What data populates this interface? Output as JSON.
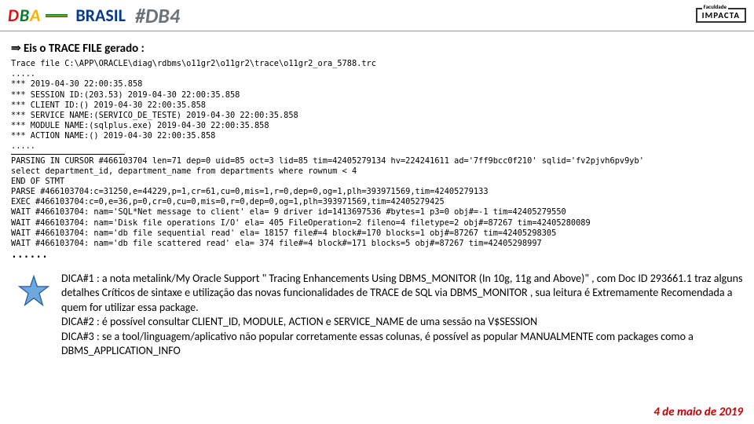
{
  "header": {
    "logo_word": "DBA",
    "brasil": "BRASIL",
    "hash": "#DB4",
    "sponsor_small": "Faculdade",
    "sponsor": "IMPACTA"
  },
  "heading_prefix": "⇒",
  "heading": "Eis o TRACE FILE gerado :",
  "trace_path": "Trace file C:\\APP\\ORACLE\\diag\\rdbms\\o11gr2\\o11gr2\\trace\\o11gr2_ora_5788.trc",
  "dots5": ".....",
  "header_block": [
    "*** 2019-04-30 22:00:35.858",
    "*** SESSION ID:(203.53) 2019-04-30 22:00:35.858",
    "*** CLIENT ID:() 2019-04-30 22:00:35.858",
    "*** SERVICE NAME:(SERVICO_DE_TESTE) 2019-04-30 22:00:35.858",
    "*** MODULE NAME:(sqlplus.exe) 2019-04-30 22:00:35.858",
    "*** ACTION NAME:() 2019-04-30 22:00:35.858"
  ],
  "parse_block": [
    "PARSING IN CURSOR #466103704 len=71 dep=0 uid=85 oct=3 lid=85 tim=42405279134 hv=224241611 ad='7ff9bcc0f210' sqlid='fv2pjvh6pv9yb'",
    "select department_id, department_name from departments where rownum < 4",
    "END OF STMT",
    "PARSE #466103704:c=31250,e=44229,p=1,cr=61,cu=0,mis=1,r=0,dep=0,og=1,plh=393971569,tim=42405279133",
    "EXEC #466103704:c=0,e=36,p=0,cr=0,cu=0,mis=0,r=0,dep=0,og=1,plh=393971569,tim=42405279425",
    "WAIT #466103704: nam='SQL*Net message to client' ela= 9 driver id=1413697536 #bytes=1 p3=0 obj#=-1 tim=42405279550",
    "WAIT #466103704: nam='Disk file operations I/O' ela= 405 FileOperation=2 fileno=4 filetype=2 obj#=87267 tim=42405280089",
    "WAIT #466103704: nam='db file sequential read' ela= 18157 file#=4 block#=170 blocks=1 obj#=87267 tim=42405298305",
    "WAIT #466103704: nam='db file scattered read' ela= 374 file#=4 block#=171 blocks=5 obj#=87267 tim=42405298997"
  ],
  "dots6": "......",
  "tips": [
    "DICA#1 : a nota metalink/My Oracle Support \" Tracing Enhancements Using DBMS_MONITOR (In 10g, 11g and Above)\" , com Doc ID 293661.1 traz alguns detalhes Críticos de sintaxe e utilização das novas funcionalidades de TRACE de SQL via DBMS_MONITOR , sua leitura é Extremamente Recomendada a quem for utilizar essa package.",
    "DICA#2 : é possível consultar CLIENT_ID, MODULE, ACTION e SERVICE_NAME de uma sessão na V$SESSION",
    "DICA#3 : se a tool/linguagem/aplicativo não popular corretamente essas colunas, é possível as popular MANUALMENTE com packages como a DBMS_APPLICATION_INFO"
  ],
  "footer_date": "4 de maio de 2019"
}
